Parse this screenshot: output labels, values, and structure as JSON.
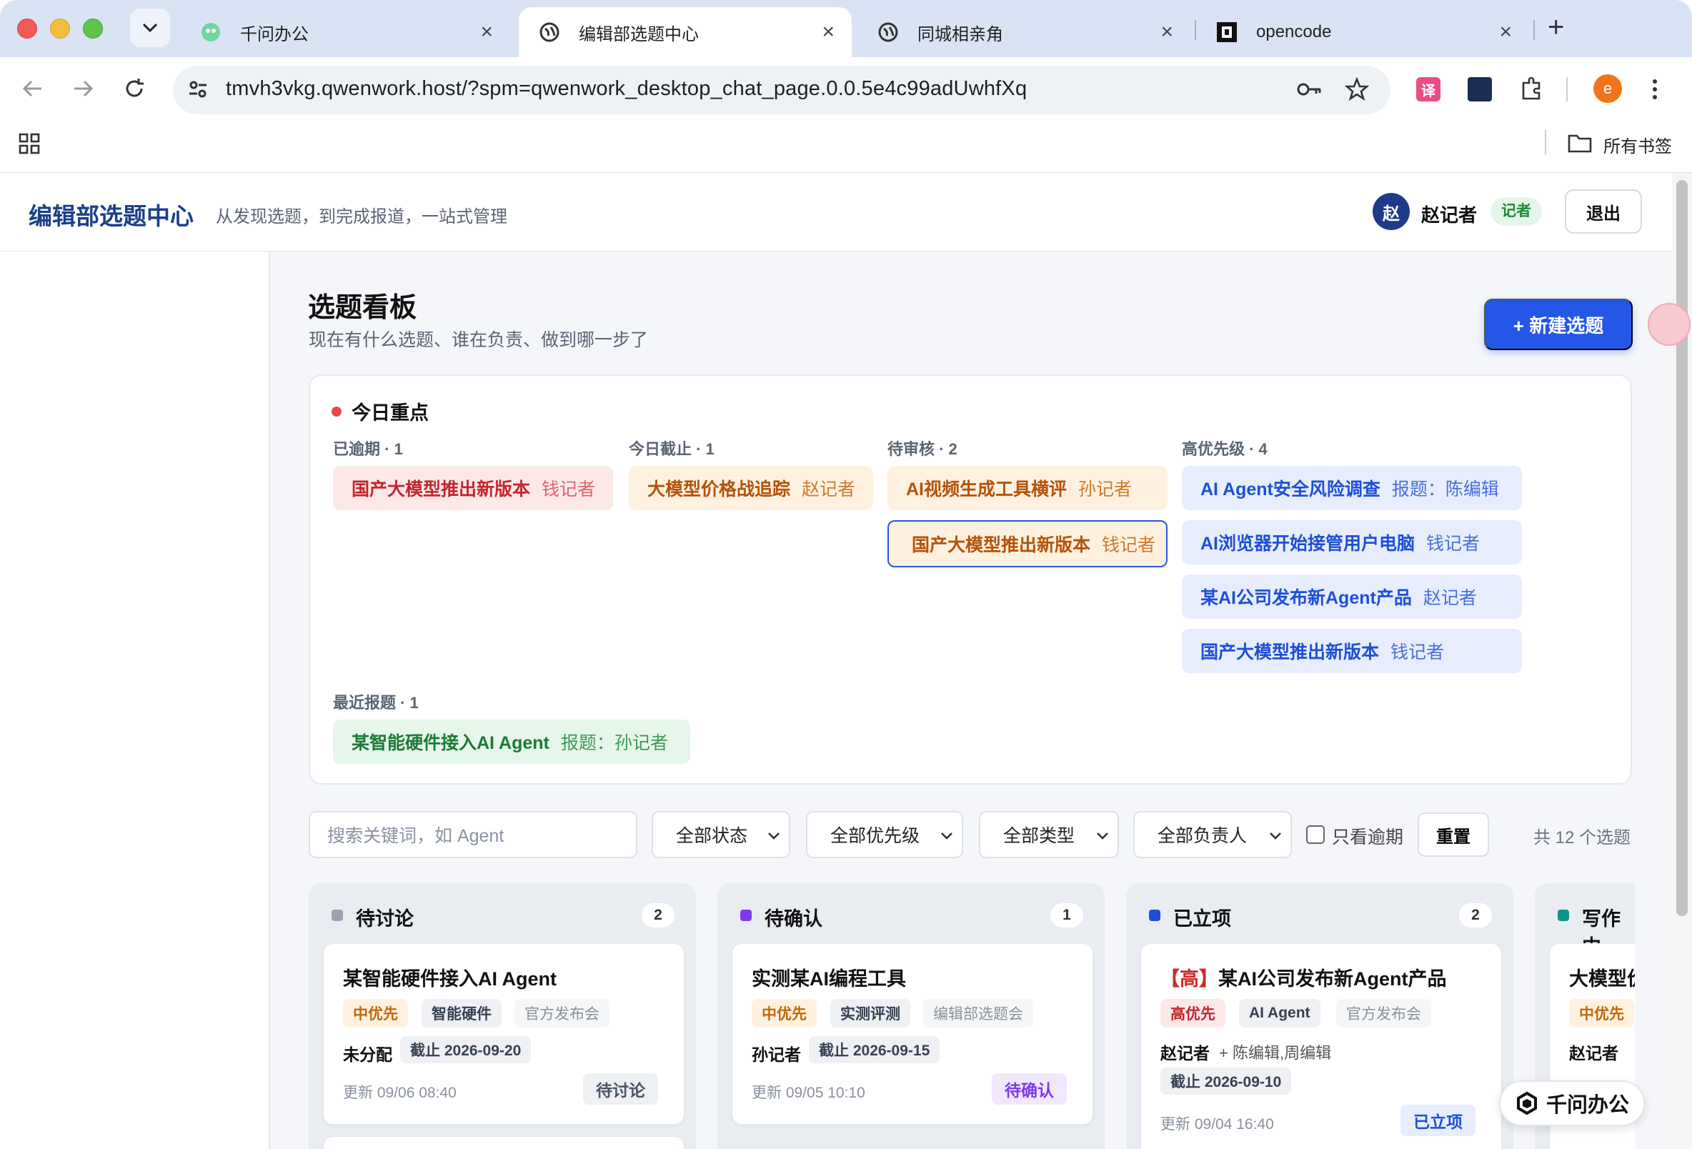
{
  "browser": {
    "tabs": [
      {
        "label": "千问办公",
        "icon": "qwen-icon"
      },
      {
        "label": "编辑部选题中心",
        "icon": "globe-icon"
      },
      {
        "label": "同城相亲角",
        "icon": "globe-icon"
      },
      {
        "label": "opencode",
        "icon": "opencode-icon"
      }
    ],
    "url": "tmvh3vkg.qwenwork.host/?spm=qwenwork_desktop_chat_page.0.0.5e4c99adUwhfXq",
    "profile_initial": "e",
    "bookmarks_label": "所有书签"
  },
  "header": {
    "brand": "编辑部选题中心",
    "tagline": "从发现选题，到完成报道，一站式管理",
    "avatar": "赵",
    "user_name": "赵记者",
    "role": "记者",
    "logout": "退出"
  },
  "page": {
    "title": "选题看板",
    "subtitle": "现在有什么选题、谁在负责、做到哪一步了",
    "new_button": "+ 新建选题"
  },
  "today": {
    "title": "今日重点",
    "overdue": {
      "label": "已逾期 · 1",
      "items": [
        {
          "title": "国产大模型推出新版本",
          "owner": "钱记者"
        }
      ]
    },
    "due_today": {
      "label": "今日截止 · 1",
      "items": [
        {
          "title": "大模型价格战追踪",
          "owner": "赵记者"
        }
      ]
    },
    "pending": {
      "label": "待审核 · 2",
      "items": [
        {
          "title": "AI视频生成工具横评",
          "owner": "孙记者"
        },
        {
          "title": "国产大模型推出新版本",
          "owner": "钱记者"
        }
      ]
    },
    "high": {
      "label": "高优先级 · 4",
      "items": [
        {
          "title": "AI Agent安全风险调查",
          "owner": "报题：陈编辑"
        },
        {
          "title": "AI浏览器开始接管用户电脑",
          "owner": "钱记者"
        },
        {
          "title": "某AI公司发布新Agent产品",
          "owner": "赵记者"
        },
        {
          "title": "国产大模型推出新版本",
          "owner": "钱记者"
        }
      ]
    },
    "recent": {
      "label": "最近报题 · 1",
      "items": [
        {
          "title": "某智能硬件接入AI Agent",
          "owner": "报题：孙记者"
        }
      ]
    }
  },
  "filters": {
    "search_placeholder": "搜索关键词，如 Agent",
    "status": "全部状态",
    "priority": "全部优先级",
    "type": "全部类型",
    "owner": "全部负责人",
    "overdue_only": "只看逾期",
    "reset": "重置",
    "total": "共 12 个选题"
  },
  "columns": [
    {
      "name": "待讨论",
      "count": "2",
      "color": "#9ca3af",
      "card": {
        "title": "某智能硬件接入AI Agent",
        "tags": [
          "中优先",
          "智能硬件",
          "官方发布会"
        ],
        "owner": "未分配",
        "due": "截止 2026-09-20",
        "updated": "更新 09/06 08:40",
        "status": "待讨论"
      }
    },
    {
      "name": "待确认",
      "count": "1",
      "color": "#7c3aed",
      "card": {
        "title": "实测某AI编程工具",
        "tags": [
          "中优先",
          "实测评测",
          "编辑部选题会"
        ],
        "owner": "孙记者",
        "due": "截止 2026-09-15",
        "updated": "更新 09/05 10:10",
        "status": "待确认"
      }
    },
    {
      "name": "已立项",
      "count": "2",
      "color": "#1d4ed8",
      "card": {
        "title": "【高】某AI公司发布新Agent产品",
        "title_prefix": "【高】",
        "title_main": "某AI公司发布新Agent产品",
        "tags": [
          "高优先",
          "AI Agent",
          "官方发布会"
        ],
        "owner": "赵记者",
        "collab": "+ 陈编辑,周编辑",
        "due": "截止 2026-09-10",
        "updated": "更新 09/04 16:40",
        "status": "已立项"
      }
    },
    {
      "name": "写作中",
      "color": "#0f9488",
      "card": {
        "title": "大模型价格战追踪",
        "tags": [
          "中优先"
        ],
        "owner": "赵记者"
      }
    }
  ],
  "floating": {
    "label": "千问办公"
  },
  "colors": {
    "accent": "#2457e6",
    "brand": "#1b3f8a"
  }
}
